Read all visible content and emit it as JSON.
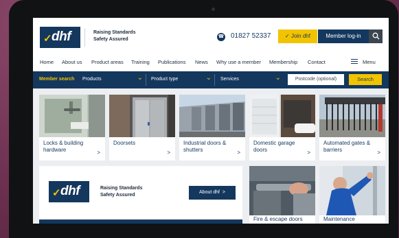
{
  "brand": {
    "logo_text": "dhf",
    "tagline_1": "Raising Standards",
    "tagline_2": "Safety Assured"
  },
  "header": {
    "phone": "01827 52337",
    "join_label": "Join dhf",
    "login_label": "Member log-in"
  },
  "nav": {
    "items": [
      "Home",
      "About us",
      "Product areas",
      "Training",
      "Publications",
      "News",
      "Why use a member",
      "Membership",
      "Contact"
    ],
    "menu_label": "Menu"
  },
  "member_search": {
    "label": "Member search",
    "products": "Products",
    "product_type": "Product type",
    "services": "Services",
    "postcode_placeholder": "Postcode (optional)",
    "search_label": "Search"
  },
  "product_cards": [
    {
      "label": "Locks & building hardware"
    },
    {
      "label": "Doorsets"
    },
    {
      "label": "Industrial doors & shutters"
    },
    {
      "label": "Domestic garage doors"
    },
    {
      "label": "Automated gates & barriers"
    }
  ],
  "promo": {
    "about_label": "About dhf"
  },
  "bottom_cards": [
    {
      "label": "Fire & escape doors"
    },
    {
      "label": "Maintenance"
    }
  ],
  "colors": {
    "navy": "#14375e",
    "yellow": "#f2c300"
  }
}
